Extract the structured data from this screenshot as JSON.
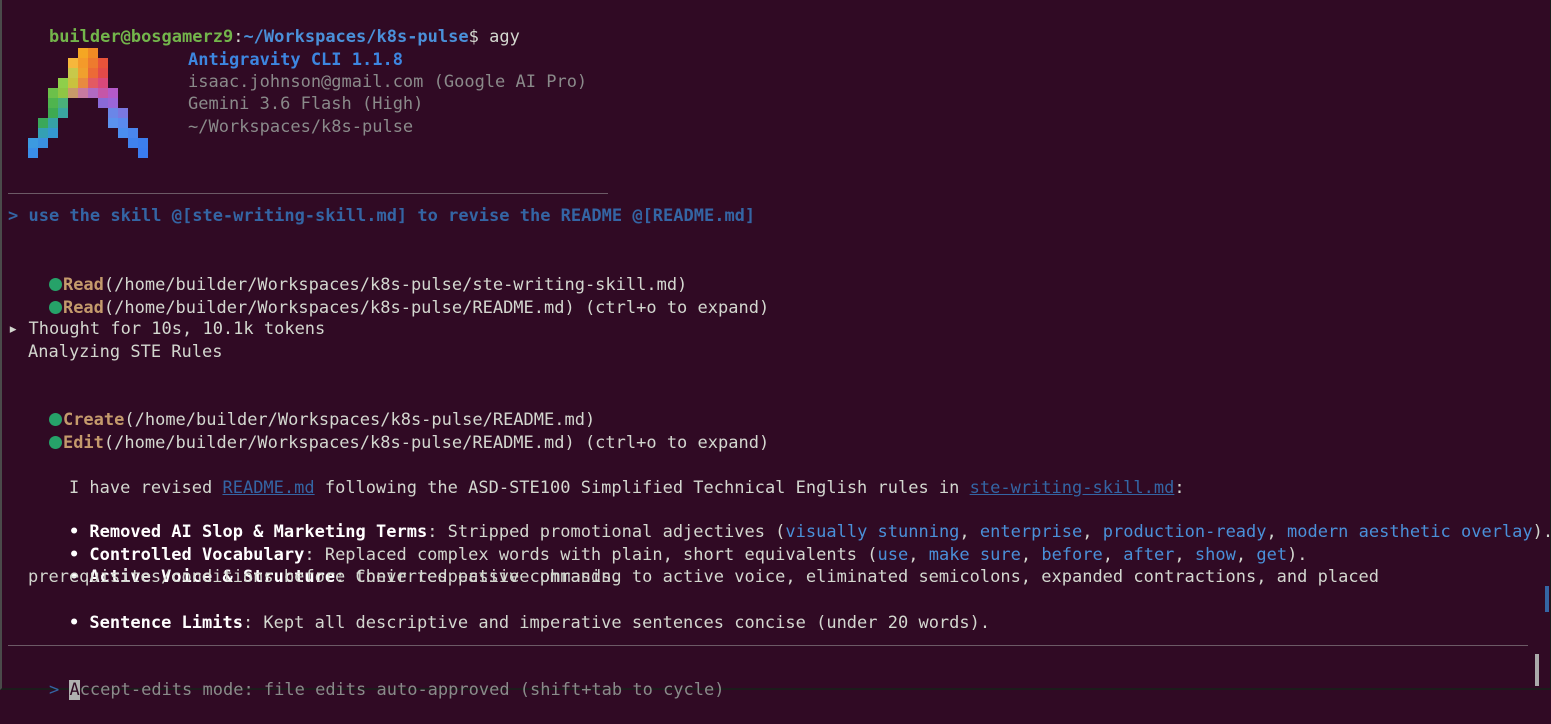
{
  "shell": {
    "user_host": "builder@bosgamerz9",
    "colon": ":",
    "cwd": "~/Workspaces/k8s-pulse",
    "dollar": "$ ",
    "command": "agy"
  },
  "banner": {
    "product": "Antigravity CLI 1.1.8",
    "account": "isaac.johnson@gmail.com (Google AI Pro)",
    "model": "Gemini 3.6 Flash (High)",
    "dir": "~/Workspaces/k8s-pulse"
  },
  "user_prompt": "> use the skill @[ste-writing-skill.md] to revise the README @[README.md]",
  "tool_calls_1": [
    {
      "name": "Read",
      "args": "(/home/builder/Workspaces/k8s-pulse/ste-writing-skill.md)"
    },
    {
      "name": "Read",
      "args": "(/home/builder/Workspaces/k8s-pulse/README.md) (ctrl+o to expand)"
    }
  ],
  "thought": {
    "header": "▸ Thought for 10s, 10.1k tokens",
    "detail": "Analyzing STE Rules"
  },
  "tool_calls_2": [
    {
      "name": "Create",
      "args": "(/home/builder/Workspaces/k8s-pulse/README.md)"
    },
    {
      "name": "Edit",
      "args": "(/home/builder/Workspaces/k8s-pulse/README.md) (ctrl+o to expand)"
    }
  ],
  "summary": {
    "pre": "I have revised ",
    "link1": "README.md",
    "mid": " following the ASD-STE100 Simplified Technical English rules in ",
    "link2": "ste-writing-skill.md",
    "post": ":"
  },
  "bullets": {
    "b1_title": "• Removed AI Slop & Marketing Terms",
    "b1_pre": ": Stripped promotional adjectives (",
    "b1_terms": [
      "visually stunning",
      "enterprise",
      "production-ready",
      "modern aesthetic overlay"
    ],
    "b1_post": ").",
    "b2_title": "• Controlled Vocabulary",
    "b2_pre": ": Replaced complex words with plain, short equivalents (",
    "b2_terms": [
      "use",
      "make sure",
      "before",
      "after",
      "show",
      "get"
    ],
    "b2_post": ").",
    "b3_title": "• Active Voice & Structure",
    "b3_text": ": Converted passive phrasing to active voice, eliminated semicolons, expanded contractions, and placed",
    "b3_cont": "prerequisites/conditions before their respective commands.",
    "b4_title": "• Sentence Limits",
    "b4_text": ": Kept all descriptive and imperative sentences concise (under 20 words)."
  },
  "input": {
    "prompt": "> ",
    "cursor_char": "A",
    "placeholder": "ccept-edits mode: file edits auto-approved (shift+tab to cycle)"
  },
  "colors": {
    "background": "#300a24",
    "accent_blue": "#3465a4",
    "tool_dot": "#26a269"
  }
}
